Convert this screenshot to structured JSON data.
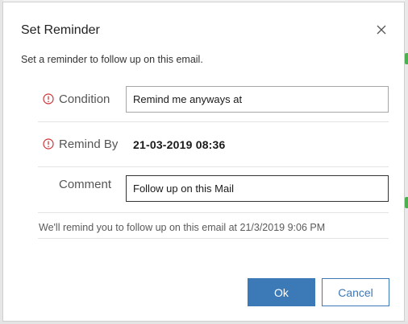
{
  "dialog": {
    "title": "Set Reminder",
    "subtitle": "Set a reminder to follow up on this email.",
    "close_icon": "close-icon"
  },
  "fields": {
    "condition": {
      "label": "Condition",
      "value": "Remind me anyways at",
      "required": true
    },
    "remind_by": {
      "label": "Remind By",
      "value": "21-03-2019 08:36",
      "required": true
    },
    "comment": {
      "label": "Comment",
      "value": "Follow up on this Mail",
      "required": false
    }
  },
  "footnote": "We'll remind you to follow up on this email at 21/3/2019 9:06 PM",
  "buttons": {
    "ok": "Ok",
    "cancel": "Cancel"
  },
  "colors": {
    "accent": "#3b79b7",
    "required": "#d13438",
    "background_green": "#4caf50"
  }
}
